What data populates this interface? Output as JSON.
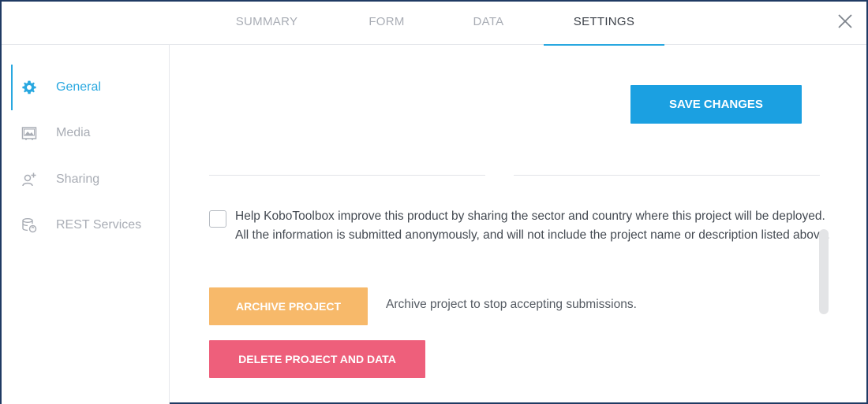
{
  "tabs": [
    {
      "label": "SUMMARY"
    },
    {
      "label": "FORM"
    },
    {
      "label": "DATA"
    },
    {
      "label": "SETTINGS",
      "active": true
    }
  ],
  "sidebar": {
    "items": [
      {
        "label": "General",
        "icon": "gear-icon",
        "active": true
      },
      {
        "label": "Media",
        "icon": "media-icon"
      },
      {
        "label": "Sharing",
        "icon": "add-user-icon"
      },
      {
        "label": "REST Services",
        "icon": "database-sync-icon"
      }
    ]
  },
  "main": {
    "save_label": "SAVE CHANGES",
    "consent_text": "Help KoboToolbox improve this product by sharing the sector and country where this project will be deployed. All the information is submitted anonymously, and will not include the project name or description listed above.",
    "archive_label": "ARCHIVE PROJECT",
    "archive_hint": "Archive project to stop accepting submissions.",
    "delete_label": "DELETE PROJECT AND DATA"
  },
  "colors": {
    "accent": "#29a8e0",
    "save_button": "#1ba0e1",
    "archive_button": "#f7b96a",
    "delete_button": "#ee5f7b",
    "frame_border": "#1f3a63"
  }
}
